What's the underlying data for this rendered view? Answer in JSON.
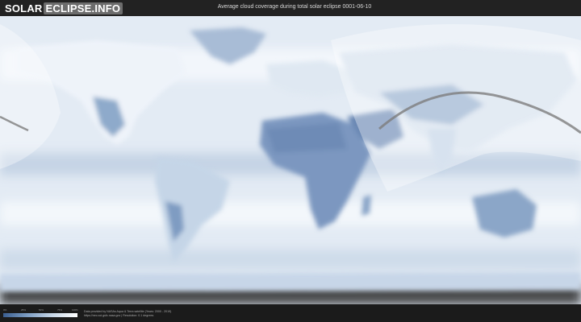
{
  "header": {
    "logo_part1": "SOLAR",
    "logo_part2": "ECLIPSE.INFO",
    "title": "Average cloud coverage during total solar eclipse 0001-06-10"
  },
  "legend": {
    "ticks": [
      "0%",
      "25%",
      "50%",
      "75%",
      "100%"
    ],
    "colors": [
      "#3b5f91",
      "#7f9fc4",
      "#c9d8e8",
      "#ffffff"
    ]
  },
  "footer": {
    "credit_line1": "Data provided by NASAs Aqua & Terra satellite (Years: 2000 - 2019)",
    "credit_line2": "https://neo.sci.gsfc.nasa.gov | Resolution: 0.1 degrees"
  },
  "colors": {
    "ocean_low": "#dfe8f2",
    "cloud_white": "#f4f8fc",
    "clear_dark": "#6f8fb8",
    "eclipse_path": "#7d7d7d",
    "daylight_overlay": "#ffffff"
  }
}
